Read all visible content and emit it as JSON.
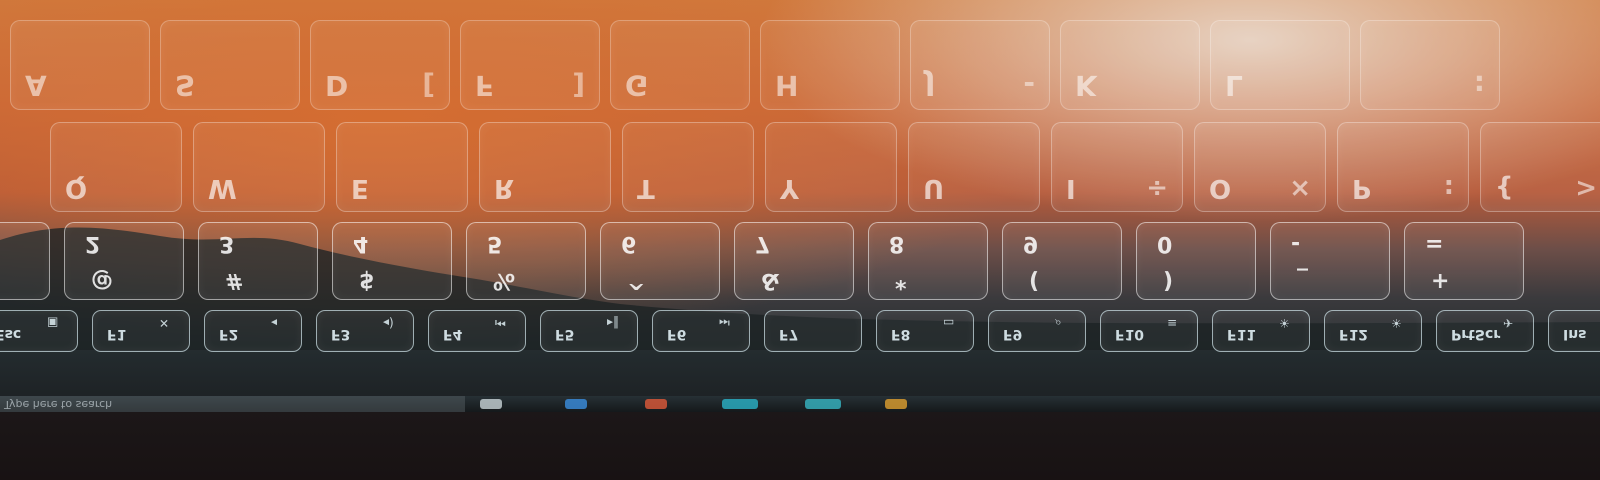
{
  "row_home": [
    {
      "main": "A",
      "sub": ""
    },
    {
      "main": "S",
      "sub": ""
    },
    {
      "main": "D",
      "sub": "["
    },
    {
      "main": "F",
      "sub": "]"
    },
    {
      "main": "G",
      "sub": ""
    },
    {
      "main": "H",
      "sub": ""
    },
    {
      "main": "J",
      "sub": "-"
    },
    {
      "main": "K",
      "sub": ""
    },
    {
      "main": "L",
      "sub": ""
    },
    {
      "main": "",
      "sub": ":"
    }
  ],
  "row_qwerty": [
    {
      "main": "Q",
      "sub": ""
    },
    {
      "main": "W",
      "sub": ""
    },
    {
      "main": "E",
      "sub": ""
    },
    {
      "main": "R",
      "sub": ""
    },
    {
      "main": "T",
      "sub": ""
    },
    {
      "main": "Y",
      "sub": ""
    },
    {
      "main": "U",
      "sub": ""
    },
    {
      "main": "I",
      "sub": "÷"
    },
    {
      "main": "O",
      "sub": "×"
    },
    {
      "main": "P",
      "sub": ":"
    },
    {
      "main": "{",
      "sub": ">"
    }
  ],
  "row_numbers": [
    {
      "upper": "",
      "main": "!",
      "sub": ""
    },
    {
      "upper": "2",
      "main": "@",
      "sub": ""
    },
    {
      "upper": "3",
      "main": "#",
      "sub": ""
    },
    {
      "upper": "4",
      "main": "$",
      "sub": ""
    },
    {
      "upper": "5",
      "main": "%",
      "sub": ""
    },
    {
      "upper": "6",
      "main": "^",
      "sub": ""
    },
    {
      "upper": "7",
      "main": "&",
      "sub": ""
    },
    {
      "upper": "8",
      "main": "*",
      "sub": ""
    },
    {
      "upper": "9",
      "main": "(",
      "sub": ""
    },
    {
      "upper": "0",
      "main": ")",
      "sub": ""
    },
    {
      "upper": "-",
      "main": "_",
      "sub": ""
    },
    {
      "upper": "=",
      "main": "+",
      "sub": ""
    }
  ],
  "row_function": [
    {
      "label": "Esc",
      "icon": "lock-icon"
    },
    {
      "label": "F1",
      "icon": "mute-icon"
    },
    {
      "label": "F2",
      "icon": "volume-down-icon"
    },
    {
      "label": "F3",
      "icon": "volume-up-icon"
    },
    {
      "label": "F4",
      "icon": "previous-track-icon"
    },
    {
      "label": "F5",
      "icon": "play-pause-icon"
    },
    {
      "label": "F6",
      "icon": "next-track-icon"
    },
    {
      "label": "F7",
      "icon": ""
    },
    {
      "label": "F8",
      "icon": "display-icon"
    },
    {
      "label": "F9",
      "icon": "search-icon"
    },
    {
      "label": "F10",
      "icon": "backlight-icon"
    },
    {
      "label": "F11",
      "icon": "brightness-down-icon"
    },
    {
      "label": "F12",
      "icon": "brightness-up-icon"
    },
    {
      "label": "PrtScr",
      "icon": "airplane-mode-icon"
    },
    {
      "label": "Ins",
      "icon": ""
    }
  ],
  "taskbar": {
    "search_placeholder": "Type here to search",
    "icons": [
      {
        "name": "task-view-icon",
        "color": "#c9d4d8"
      },
      {
        "name": "edge-icon",
        "color": "#3b8fe0"
      },
      {
        "name": "shield-app-icon",
        "color": "#e05a3a"
      },
      {
        "name": "store-icon",
        "color": "#2bb3c8"
      },
      {
        "name": "file-explorer-icon",
        "color": "#37b7c4"
      },
      {
        "name": "chrome-icon",
        "color": "#e0a030"
      }
    ]
  },
  "colors": {
    "sky_orange": "#cf7a3e",
    "key_outline": "#d2e6eb",
    "background_dark": "#171314"
  }
}
